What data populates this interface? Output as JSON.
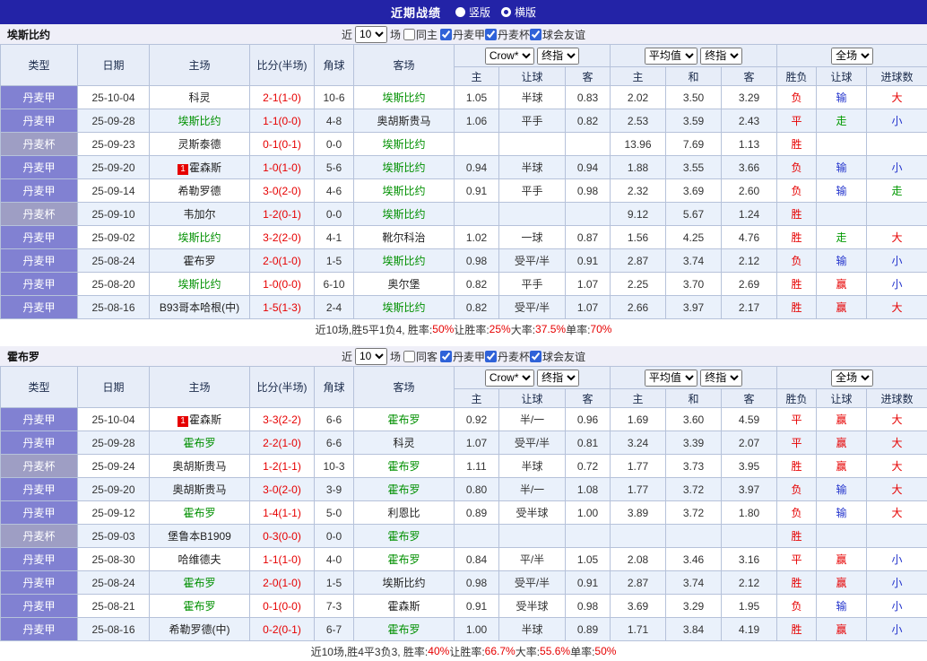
{
  "titlebar": {
    "title": "近期战绩",
    "radios": [
      {
        "label": "竖版",
        "checked": false
      },
      {
        "label": "横版",
        "checked": true
      }
    ]
  },
  "filter": {
    "near_label": "近",
    "count": "10",
    "unit_label": "场",
    "leagues": [
      "丹麦甲",
      "丹麦杯",
      "球会友谊"
    ]
  },
  "table_header": {
    "static_cols": [
      "类型",
      "日期",
      "主场",
      "比分(半场)",
      "角球",
      "客场"
    ],
    "odds_group": {
      "select1": "Crow*",
      "select2": "终指",
      "cols": [
        "主",
        "让球",
        "客"
      ]
    },
    "avg_group": {
      "select1": "平均值",
      "select2": "终指",
      "cols": [
        "主",
        "和",
        "客"
      ]
    },
    "result_group": {
      "select1": "全场",
      "cols": [
        "胜负",
        "让球",
        "进球数"
      ]
    }
  },
  "sections": [
    {
      "team": "埃斯比约",
      "same_side_label": "同主",
      "rows": [
        {
          "type": "丹麦甲",
          "date": "25-10-04",
          "home": "科灵",
          "home_focus": false,
          "home_badge": "",
          "score": "2-1(1-0)",
          "corner": "10-6",
          "away": "埃斯比约",
          "away_focus": true,
          "away_badge": "",
          "odds": [
            "1.05",
            "半球",
            "0.83"
          ],
          "avg": [
            "2.02",
            "3.50",
            "3.29"
          ],
          "results": [
            "负",
            "输",
            "大"
          ]
        },
        {
          "type": "丹麦甲",
          "date": "25-09-28",
          "home": "埃斯比约",
          "home_focus": true,
          "home_badge": "",
          "score": "1-1(0-0)",
          "corner": "4-8",
          "away": "奥胡斯贵马",
          "away_focus": false,
          "away_badge": "",
          "odds": [
            "1.06",
            "平手",
            "0.82"
          ],
          "avg": [
            "2.53",
            "3.59",
            "2.43"
          ],
          "results": [
            "平",
            "走",
            "小"
          ]
        },
        {
          "type": "丹麦杯",
          "date": "25-09-23",
          "home": "灵斯泰德",
          "home_focus": false,
          "home_badge": "",
          "score": "0-1(0-1)",
          "corner": "0-0",
          "away": "埃斯比约",
          "away_focus": true,
          "away_badge": "",
          "odds": [
            "",
            "",
            ""
          ],
          "avg": [
            "13.96",
            "7.69",
            "1.13"
          ],
          "results": [
            "胜",
            "",
            ""
          ]
        },
        {
          "type": "丹麦甲",
          "date": "25-09-20",
          "home": "霍森斯",
          "home_focus": false,
          "home_badge": "1",
          "score": "1-0(1-0)",
          "corner": "5-6",
          "away": "埃斯比约",
          "away_focus": true,
          "away_badge": "",
          "odds": [
            "0.94",
            "半球",
            "0.94"
          ],
          "avg": [
            "1.88",
            "3.55",
            "3.66"
          ],
          "results": [
            "负",
            "输",
            "小"
          ]
        },
        {
          "type": "丹麦甲",
          "date": "25-09-14",
          "home": "希勒罗德",
          "home_focus": false,
          "home_badge": "",
          "score": "3-0(2-0)",
          "corner": "4-6",
          "away": "埃斯比约",
          "away_focus": true,
          "away_badge": "",
          "odds": [
            "0.91",
            "平手",
            "0.98"
          ],
          "avg": [
            "2.32",
            "3.69",
            "2.60"
          ],
          "results": [
            "负",
            "输",
            "走"
          ]
        },
        {
          "type": "丹麦杯",
          "date": "25-09-10",
          "home": "韦加尔",
          "home_focus": false,
          "home_badge": "",
          "score": "1-2(0-1)",
          "corner": "0-0",
          "away": "埃斯比约",
          "away_focus": true,
          "away_badge": "",
          "odds": [
            "",
            "",
            ""
          ],
          "avg": [
            "9.12",
            "5.67",
            "1.24"
          ],
          "results": [
            "胜",
            "",
            ""
          ]
        },
        {
          "type": "丹麦甲",
          "date": "25-09-02",
          "home": "埃斯比约",
          "home_focus": true,
          "home_badge": "",
          "score": "3-2(2-0)",
          "corner": "4-1",
          "away": "靴尔科治",
          "away_focus": false,
          "away_badge": "",
          "odds": [
            "1.02",
            "一球",
            "0.87"
          ],
          "avg": [
            "1.56",
            "4.25",
            "4.76"
          ],
          "results": [
            "胜",
            "走",
            "大"
          ]
        },
        {
          "type": "丹麦甲",
          "date": "25-08-24",
          "home": "霍布罗",
          "home_focus": false,
          "home_badge": "",
          "score": "2-0(1-0)",
          "corner": "1-5",
          "away": "埃斯比约",
          "away_focus": true,
          "away_badge": "",
          "odds": [
            "0.98",
            "受平/半",
            "0.91"
          ],
          "avg": [
            "2.87",
            "3.74",
            "2.12"
          ],
          "results": [
            "负",
            "输",
            "小"
          ]
        },
        {
          "type": "丹麦甲",
          "date": "25-08-20",
          "home": "埃斯比约",
          "home_focus": true,
          "home_badge": "",
          "score": "1-0(0-0)",
          "corner": "6-10",
          "away": "奥尔堡",
          "away_focus": false,
          "away_badge": "",
          "odds": [
            "0.82",
            "平手",
            "1.07"
          ],
          "avg": [
            "2.25",
            "3.70",
            "2.69"
          ],
          "results": [
            "胜",
            "赢",
            "小"
          ]
        },
        {
          "type": "丹麦甲",
          "date": "25-08-16",
          "home": "B93哥本哈根(中)",
          "home_focus": false,
          "home_badge": "",
          "score": "1-5(1-3)",
          "corner": "2-4",
          "away": "埃斯比约",
          "away_focus": true,
          "away_badge": "",
          "odds": [
            "0.82",
            "受平/半",
            "1.07"
          ],
          "avg": [
            "2.66",
            "3.97",
            "2.17"
          ],
          "results": [
            "胜",
            "赢",
            "大"
          ]
        }
      ],
      "summary": [
        {
          "text": "近10场,胜5平1负4, 胜率:",
          "red": false
        },
        {
          "text": "50%",
          "red": true
        },
        {
          "text": " 让胜率:",
          "red": false
        },
        {
          "text": "25%",
          "red": true
        },
        {
          "text": " 大率:",
          "red": false
        },
        {
          "text": "37.5%",
          "red": true
        },
        {
          "text": " 单率:",
          "red": false
        },
        {
          "text": "70%",
          "red": true
        }
      ]
    },
    {
      "team": "霍布罗",
      "same_side_label": "同客",
      "rows": [
        {
          "type": "丹麦甲",
          "date": "25-10-04",
          "home": "霍森斯",
          "home_focus": false,
          "home_badge": "1",
          "score": "3-3(2-2)",
          "corner": "6-6",
          "away": "霍布罗",
          "away_focus": true,
          "away_badge": "",
          "odds": [
            "0.92",
            "半/一",
            "0.96"
          ],
          "avg": [
            "1.69",
            "3.60",
            "4.59"
          ],
          "results": [
            "平",
            "赢",
            "大"
          ]
        },
        {
          "type": "丹麦甲",
          "date": "25-09-28",
          "home": "霍布罗",
          "home_focus": true,
          "home_badge": "",
          "score": "2-2(1-0)",
          "corner": "6-6",
          "away": "科灵",
          "away_focus": false,
          "away_badge": "",
          "odds": [
            "1.07",
            "受平/半",
            "0.81"
          ],
          "avg": [
            "3.24",
            "3.39",
            "2.07"
          ],
          "results": [
            "平",
            "赢",
            "大"
          ]
        },
        {
          "type": "丹麦杯",
          "date": "25-09-24",
          "home": "奥胡斯贵马",
          "home_focus": false,
          "home_badge": "",
          "score": "1-2(1-1)",
          "corner": "10-3",
          "away": "霍布罗",
          "away_focus": true,
          "away_badge": "",
          "odds": [
            "1.11",
            "半球",
            "0.72"
          ],
          "avg": [
            "1.77",
            "3.73",
            "3.95"
          ],
          "results": [
            "胜",
            "赢",
            "大"
          ]
        },
        {
          "type": "丹麦甲",
          "date": "25-09-20",
          "home": "奥胡斯贵马",
          "home_focus": false,
          "home_badge": "",
          "score": "3-0(2-0)",
          "corner": "3-9",
          "away": "霍布罗",
          "away_focus": true,
          "away_badge": "",
          "odds": [
            "0.80",
            "半/一",
            "1.08"
          ],
          "avg": [
            "1.77",
            "3.72",
            "3.97"
          ],
          "results": [
            "负",
            "输",
            "大"
          ]
        },
        {
          "type": "丹麦甲",
          "date": "25-09-12",
          "home": "霍布罗",
          "home_focus": true,
          "home_badge": "",
          "score": "1-4(1-1)",
          "corner": "5-0",
          "away": "利恩比",
          "away_focus": false,
          "away_badge": "",
          "odds": [
            "0.89",
            "受半球",
            "1.00"
          ],
          "avg": [
            "3.89",
            "3.72",
            "1.80"
          ],
          "results": [
            "负",
            "输",
            "大"
          ]
        },
        {
          "type": "丹麦杯",
          "date": "25-09-03",
          "home": "堡鲁本B1909",
          "home_focus": false,
          "home_badge": "",
          "score": "0-3(0-0)",
          "corner": "0-0",
          "away": "霍布罗",
          "away_focus": true,
          "away_badge": "",
          "odds": [
            "",
            "",
            ""
          ],
          "avg": [
            "",
            "",
            ""
          ],
          "results": [
            "胜",
            "",
            ""
          ]
        },
        {
          "type": "丹麦甲",
          "date": "25-08-30",
          "home": "哈维德夫",
          "home_focus": false,
          "home_badge": "",
          "score": "1-1(1-0)",
          "corner": "4-0",
          "away": "霍布罗",
          "away_focus": true,
          "away_badge": "",
          "odds": [
            "0.84",
            "平/半",
            "1.05"
          ],
          "avg": [
            "2.08",
            "3.46",
            "3.16"
          ],
          "results": [
            "平",
            "赢",
            "小"
          ]
        },
        {
          "type": "丹麦甲",
          "date": "25-08-24",
          "home": "霍布罗",
          "home_focus": true,
          "home_badge": "",
          "score": "2-0(1-0)",
          "corner": "1-5",
          "away": "埃斯比约",
          "away_focus": false,
          "away_badge": "",
          "odds": [
            "0.98",
            "受平/半",
            "0.91"
          ],
          "avg": [
            "2.87",
            "3.74",
            "2.12"
          ],
          "results": [
            "胜",
            "赢",
            "小"
          ]
        },
        {
          "type": "丹麦甲",
          "date": "25-08-21",
          "home": "霍布罗",
          "home_focus": true,
          "home_badge": "",
          "score": "0-1(0-0)",
          "corner": "7-3",
          "away": "霍森斯",
          "away_focus": false,
          "away_badge": "",
          "odds": [
            "0.91",
            "受半球",
            "0.98"
          ],
          "avg": [
            "3.69",
            "3.29",
            "1.95"
          ],
          "results": [
            "负",
            "输",
            "小"
          ]
        },
        {
          "type": "丹麦甲",
          "date": "25-08-16",
          "home": "希勒罗德(中)",
          "home_focus": false,
          "home_badge": "",
          "score": "0-2(0-1)",
          "corner": "6-7",
          "away": "霍布罗",
          "away_focus": true,
          "away_badge": "",
          "odds": [
            "1.00",
            "半球",
            "0.89"
          ],
          "avg": [
            "1.71",
            "3.84",
            "4.19"
          ],
          "results": [
            "胜",
            "赢",
            "小"
          ]
        }
      ],
      "summary": [
        {
          "text": "近10场,胜4平3负3, 胜率:",
          "red": false
        },
        {
          "text": "40%",
          "red": true
        },
        {
          "text": " 让胜率:",
          "red": false
        },
        {
          "text": "66.7%",
          "red": true
        },
        {
          "text": " 大率:",
          "red": false
        },
        {
          "text": "55.6%",
          "red": true
        },
        {
          "text": " 单率:",
          "red": false
        },
        {
          "text": "50%",
          "red": true
        }
      ]
    }
  ],
  "colors": {
    "titlebar": "#2323a7",
    "filter-bg": "#efeff8",
    "header-bg": "#e7edf8",
    "row-alt": "#eaf1fb",
    "grid-border": "#b6c2da",
    "league-bg": "#8181d2",
    "cup-bg": "#9e9ec4",
    "focus-team": "#009000",
    "red": "#e60000",
    "blue": "#2233cc",
    "green": "#009900",
    "check-blue": "#2f62d8"
  }
}
